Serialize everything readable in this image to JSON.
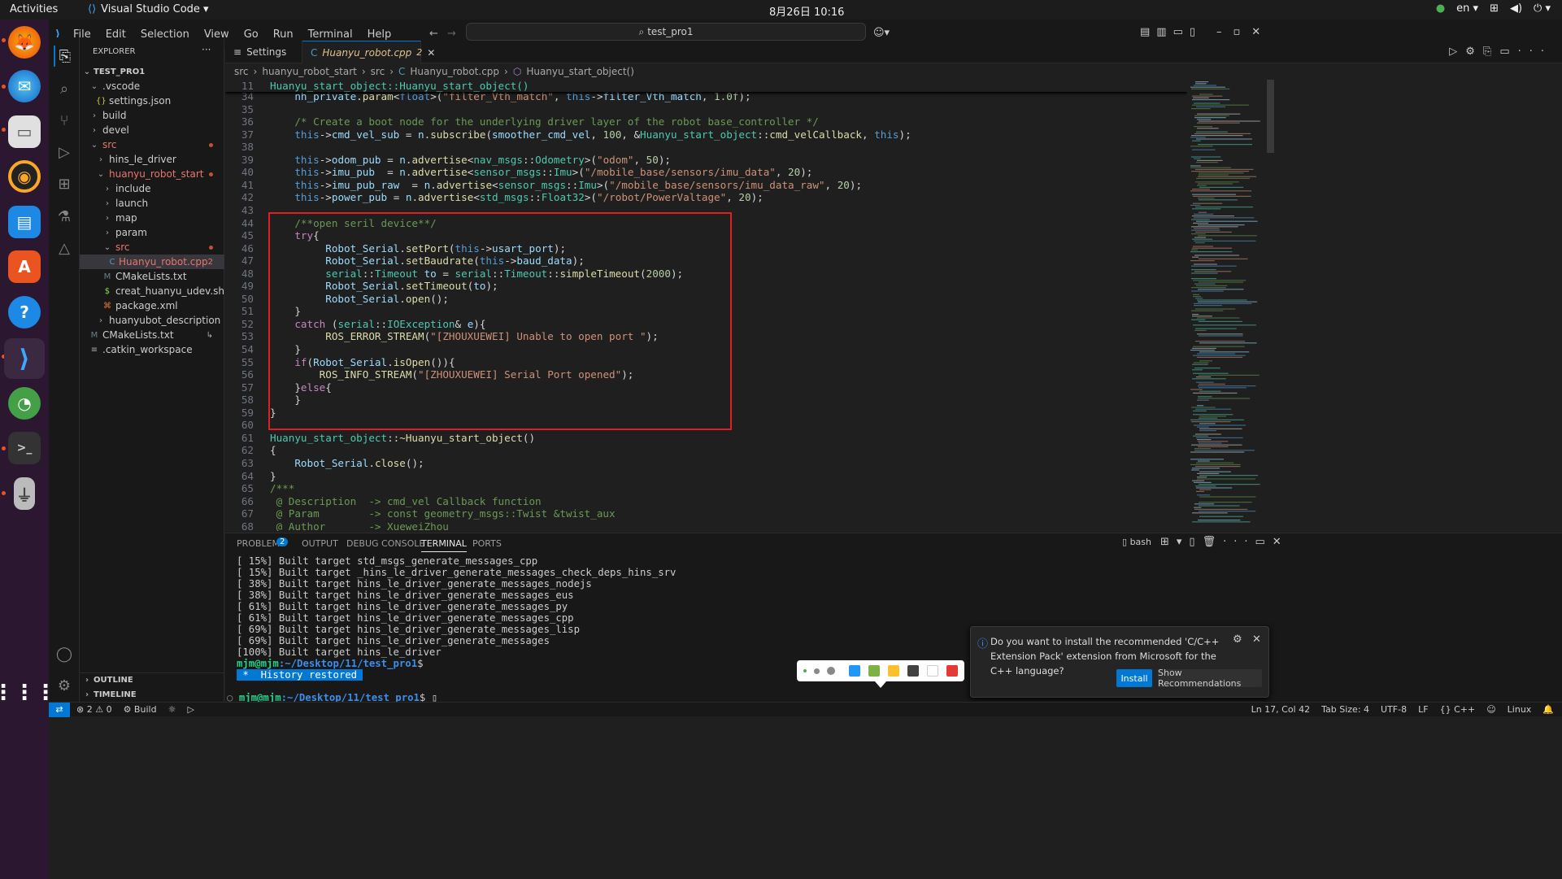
{
  "topbar": {
    "activities": "Activities",
    "app_name": "Visual Studio Code ▾",
    "clock": "8月26日  10:16",
    "lang": "en ▾"
  },
  "titlebar": {
    "menus": [
      "File",
      "Edit",
      "Selection",
      "View",
      "Go",
      "Run",
      "Terminal",
      "Help"
    ],
    "search": "test_pro1"
  },
  "sidebar": {
    "header": "EXPLORER",
    "project": "TEST_PRO1",
    "items": [
      {
        "label": ".vscode",
        "depth": 1,
        "kind": "folder-open"
      },
      {
        "label": "settings.json",
        "depth": 2,
        "kind": "json"
      },
      {
        "label": "build",
        "depth": 1,
        "kind": "folder"
      },
      {
        "label": "devel",
        "depth": 1,
        "kind": "folder"
      },
      {
        "label": "src",
        "depth": 1,
        "kind": "folder-open",
        "modified": true
      },
      {
        "label": "hins_le_driver",
        "depth": 2,
        "kind": "folder"
      },
      {
        "label": "huanyu_robot_start",
        "depth": 2,
        "kind": "folder-open",
        "modified": true
      },
      {
        "label": "include",
        "depth": 3,
        "kind": "folder"
      },
      {
        "label": "launch",
        "depth": 3,
        "kind": "folder"
      },
      {
        "label": "map",
        "depth": 3,
        "kind": "folder"
      },
      {
        "label": "param",
        "depth": 3,
        "kind": "folder"
      },
      {
        "label": "src",
        "depth": 3,
        "kind": "folder-open",
        "modified": true
      },
      {
        "label": "Huanyu_robot.cpp",
        "depth": 4,
        "kind": "cpp",
        "badge": "2",
        "selected": true
      },
      {
        "label": "CMakeLists.txt",
        "depth": 3,
        "kind": "cmake"
      },
      {
        "label": "creat_huanyu_udev.sh",
        "depth": 3,
        "kind": "sh"
      },
      {
        "label": "package.xml",
        "depth": 3,
        "kind": "xml"
      },
      {
        "label": "huanyubot_description",
        "depth": 2,
        "kind": "folder"
      },
      {
        "label": "CMakeLists.txt",
        "depth": 1,
        "kind": "cmake",
        "badge": "↳"
      },
      {
        "label": ".catkin_workspace",
        "depth": 1,
        "kind": "file"
      }
    ],
    "outline": "OUTLINE",
    "timeline": "TIMELINE"
  },
  "tabs": [
    {
      "label": "Settings",
      "icon": "settings-icon"
    },
    {
      "label": "Huanyu_robot.cpp",
      "badge": "2",
      "active": true
    }
  ],
  "breadcrumb": [
    "src",
    "huanyu_robot_start",
    "src",
    "Huanyu_robot.cpp",
    "Huanyu_start_object()"
  ],
  "editor": {
    "sticky": {
      "ln": "11",
      "text": "Huanyu_start_object::Huanyu_start_object()"
    },
    "lines": [
      {
        "ln": "34",
        "html": "    <span class='v'>nh_private</span>.<span class='f'>param</span>&lt;<span class='k'>float</span>&gt;(<span class='s'>\"filter_Vth_match\"</span>, <span class='k'>this</span>-&gt;<span class='v'>filter_Vth_match</span>, <span class='n'>1.0f</span>);"
      },
      {
        "ln": "35",
        "html": ""
      },
      {
        "ln": "36",
        "html": "    <span class='c'>/* Create a boot node for the underlying driver layer of the robot base_controller */</span>"
      },
      {
        "ln": "37",
        "html": "    <span class='k'>this</span>-&gt;<span class='v'>cmd_vel_sub</span> = <span class='v'>n</span>.<span class='f'>subscribe</span>(<span class='v'>smoother_cmd_vel</span>, <span class='n'>100</span>, &amp;<span class='t'>Huanyu_start_object</span>::<span class='f'>cmd_velCallback</span>, <span class='k'>this</span>);"
      },
      {
        "ln": "38",
        "html": ""
      },
      {
        "ln": "39",
        "html": "    <span class='k'>this</span>-&gt;<span class='v'>odom_pub</span> = <span class='v'>n</span>.<span class='f'>advertise</span>&lt;<span class='t'>nav_msgs</span>::<span class='t'>Odometry</span>&gt;(<span class='s'>\"odom\"</span>, <span class='n'>50</span>);"
      },
      {
        "ln": "40",
        "html": "    <span class='k'>this</span>-&gt;<span class='v'>imu_pub</span>  = <span class='v'>n</span>.<span class='f'>advertise</span>&lt;<span class='t'>sensor_msgs</span>::<span class='t'>Imu</span>&gt;(<span class='s'>\"/mobile_base/sensors/imu_data\"</span>, <span class='n'>20</span>);"
      },
      {
        "ln": "41",
        "html": "    <span class='k'>this</span>-&gt;<span class='v'>imu_pub_raw</span>  = <span class='v'>n</span>.<span class='f'>advertise</span>&lt;<span class='t'>sensor_msgs</span>::<span class='t'>Imu</span>&gt;(<span class='s'>\"/mobile_base/sensors/imu_data_raw\"</span>, <span class='n'>20</span>);"
      },
      {
        "ln": "42",
        "html": "    <span class='k'>this</span>-&gt;<span class='v'>power_pub</span> = <span class='v'>n</span>.<span class='f'>advertise</span>&lt;<span class='t'>std_msgs</span>::<span class='t'>Float32</span>&gt;(<span class='s'>\"/robot/PowerValtage\"</span>, <span class='n'>20</span>);"
      },
      {
        "ln": "43",
        "html": ""
      },
      {
        "ln": "44",
        "html": "    <span class='c'>/**open seril device**/</span>"
      },
      {
        "ln": "45",
        "html": "    <span class='kc'>try</span>{"
      },
      {
        "ln": "46",
        "html": "         <span class='v'>Robot_Serial</span>.<span class='f'>setPort</span>(<span class='k'>this</span>-&gt;<span class='v'>usart_port</span>);"
      },
      {
        "ln": "47",
        "html": "         <span class='v'>Robot_Serial</span>.<span class='f'>setBaudrate</span>(<span class='k'>this</span>-&gt;<span class='v'>baud_data</span>);"
      },
      {
        "ln": "48",
        "html": "         <span class='t'>serial</span>::<span class='t'>Timeout</span> <span class='v'>to</span> = <span class='t'>serial</span>::<span class='t'>Timeout</span>::<span class='f'>simpleTimeout</span>(<span class='n'>2000</span>);"
      },
      {
        "ln": "49",
        "html": "         <span class='v'>Robot_Serial</span>.<span class='f'>setTimeout</span>(<span class='v'>to</span>);"
      },
      {
        "ln": "50",
        "html": "         <span class='v'>Robot_Serial</span>.<span class='f'>open</span>();"
      },
      {
        "ln": "51",
        "html": "    }"
      },
      {
        "ln": "52",
        "html": "    <span class='kc'>catch</span> (<span class='t'>serial</span>::<span class='t'>IOException</span>&amp; <span class='v'>e</span>){"
      },
      {
        "ln": "53",
        "html": "         <span class='f'>ROS_ERROR_STREAM</span>(<span class='s'>\"[ZHOUXUEWEI] Unable to open port \"</span>);"
      },
      {
        "ln": "54",
        "html": "    }"
      },
      {
        "ln": "55",
        "html": "    <span class='kc'>if</span>(<span class='v'>Robot_Serial</span>.<span class='f'>isOpen</span>()){"
      },
      {
        "ln": "56",
        "html": "        <span class='f'>ROS_INFO_STREAM</span>(<span class='s'>\"[ZHOUXUEWEI] Serial Port opened\"</span>);"
      },
      {
        "ln": "57",
        "html": "    }<span class='kc'>else</span>{"
      },
      {
        "ln": "58",
        "html": "    }"
      },
      {
        "ln": "59",
        "html": "}"
      },
      {
        "ln": "60",
        "html": ""
      },
      {
        "ln": "61",
        "html": "<span class='t'>Huanyu_start_object</span>::<span class='f'>~Huanyu_start_object</span>()"
      },
      {
        "ln": "62",
        "html": "{"
      },
      {
        "ln": "63",
        "html": "    <span class='v'>Robot_Serial</span>.<span class='f'>close</span>();"
      },
      {
        "ln": "64",
        "html": "}"
      },
      {
        "ln": "65",
        "html": "<span class='c'>/***</span>"
      },
      {
        "ln": "66",
        "html": "<span class='c'> @ Description  -&gt; cmd_vel Callback function</span>"
      },
      {
        "ln": "67",
        "html": "<span class='c'> @ Param        -&gt; const geometry_msgs::Twist &amp;twist_aux</span>"
      },
      {
        "ln": "68",
        "html": "<span class='c'> @ Author       -&gt; XueweiZhou</span>"
      }
    ]
  },
  "panel": {
    "tabs": [
      "PROBLEMS",
      "OUTPUT",
      "DEBUG CONSOLE",
      "TERMINAL",
      "PORTS"
    ],
    "problems_count": "2",
    "shell": "bash",
    "terminal_lines": [
      "[ 15%] Built target std_msgs_generate_messages_cpp",
      "[ 15%] Built target _hins_le_driver_generate_messages_check_deps_hins_srv",
      "[ 38%] Built target hins_le_driver_generate_messages_nodejs",
      "[ 38%] Built target hins_le_driver_generate_messages_eus",
      "[ 61%] Built target hins_le_driver_generate_messages_py",
      "[ 61%] Built target hins_le_driver_generate_messages_cpp",
      "[ 69%] Built target hins_le_driver_generate_messages_lisp",
      "[ 69%] Built target hins_le_driver_generate_messages",
      "[100%] Built target hins_le_driver"
    ],
    "prompt_user": "mjm@mjm",
    "prompt_path": ":~/Desktop/11/test_pro1",
    "prompt_suffix": "$",
    "history_restored": " *  History restored "
  },
  "notification": {
    "text": "Do you want to install the recommended 'C/C++ Extension Pack' extension from Microsoft for the C++ language?",
    "install": "Install",
    "show": "Show Recommendations"
  },
  "palette_colors": [
    "#2196f3",
    "#7cb342",
    "#fbc02d",
    "#424242",
    "#ffffff",
    "#e53935"
  ],
  "statusbar": {
    "problems": "⊗ 2 ⚠ 0",
    "build": "⚙ Build",
    "position": "Ln 17, Col 42",
    "tabsize": "Tab Size: 4",
    "encoding": "UTF-8",
    "eol": "LF",
    "language": "{} C++",
    "os": "Linux"
  }
}
